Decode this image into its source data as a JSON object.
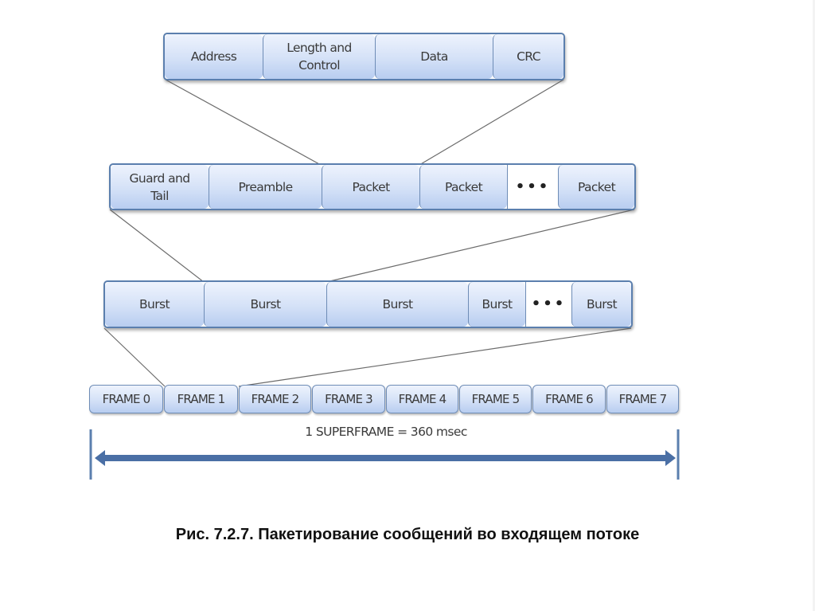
{
  "packet_fields": [
    "Address",
    "Length and\nControl",
    "Data",
    "CRC"
  ],
  "burst_fields": [
    "Guard and\nTail",
    "Preamble",
    "Packet",
    "Packet",
    "•••",
    "Packet"
  ],
  "frame_fields": [
    "Burst",
    "Burst",
    "Burst",
    "Burst",
    "•••",
    "Burst"
  ],
  "frames": [
    "FRAME 0",
    "FRAME 1",
    "FRAME 2",
    "FRAME 3",
    "FRAME 4",
    "FRAME 5",
    "FRAME 6",
    "FRAME 7"
  ],
  "superframe_label": "1 SUPERFRAME = 360 msec",
  "caption": "Рис. 7.2.7. Пакетирование сообщений во входящем потоке",
  "colors": {
    "box_fill_top": "#eef3fd",
    "box_fill_bottom": "#b8cdf0",
    "box_border": "#5b7fae",
    "arrow": "#4a6fa5",
    "connector": "#6b6b6b"
  }
}
